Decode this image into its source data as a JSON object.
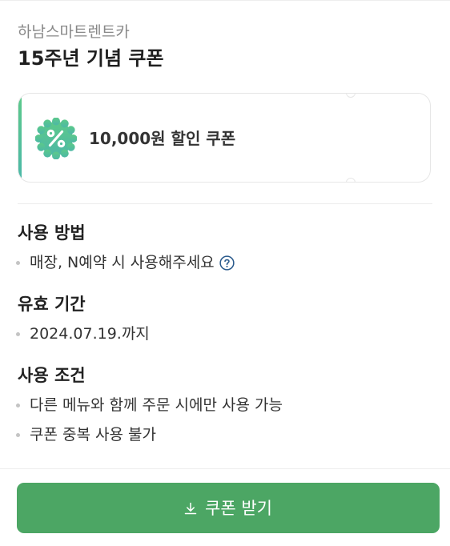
{
  "header": {
    "shop_name": "하남스마트렌트카",
    "coupon_title": "15주년 기념 쿠폰"
  },
  "coupon": {
    "badge_icon": "percent-icon",
    "discount_label": "10,000원 할인 쿠폰"
  },
  "sections": {
    "usage_method": {
      "heading": "사용 방법",
      "items": [
        "매장, N예약 시 사용해주세요"
      ],
      "help_icon": "question-icon"
    },
    "valid_period": {
      "heading": "유효 기간",
      "items": [
        "2024.07.19.까지"
      ]
    },
    "conditions": {
      "heading": "사용 조건",
      "items": [
        "다른 메뉴와 함께 주문 시에만 사용 가능",
        "쿠폰 중복 사용 불가"
      ]
    }
  },
  "footer": {
    "download_button_label": "쿠폰 받기",
    "download_icon": "download-icon"
  },
  "colors": {
    "accent_green": "#4ca664",
    "badge_green": "#5cc98a",
    "help_icon_blue": "#2a5a8c"
  }
}
